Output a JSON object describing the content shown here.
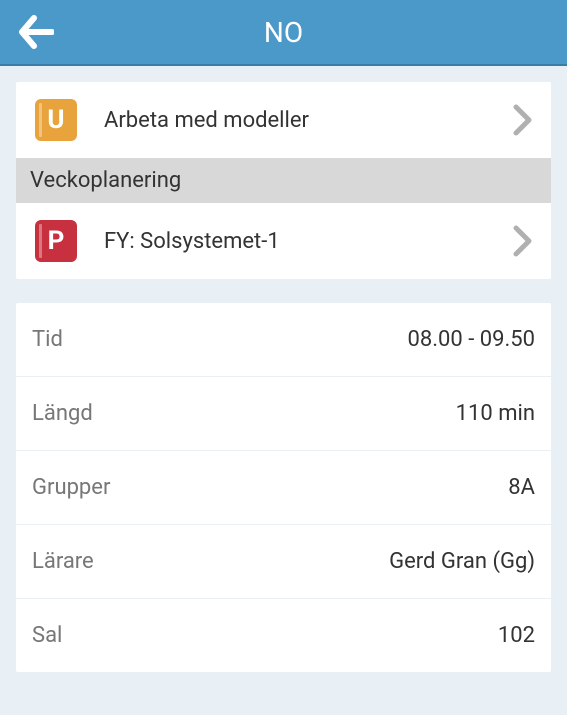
{
  "header": {
    "title": "NO"
  },
  "topList": {
    "items": [
      {
        "icon": "u-icon",
        "label": "Arbeta med modeller"
      }
    ]
  },
  "section": {
    "header": "Veckoplanering",
    "items": [
      {
        "icon": "p-icon",
        "label": "FY: Solsystemet-1"
      }
    ]
  },
  "details": [
    {
      "label": "Tid",
      "value": "08.00 - 09.50"
    },
    {
      "label": "Längd",
      "value": "110 min"
    },
    {
      "label": "Grupper",
      "value": "8A"
    },
    {
      "label": "Lärare",
      "value": "Gerd Gran (Gg)"
    },
    {
      "label": "Sal",
      "value": "102"
    }
  ]
}
